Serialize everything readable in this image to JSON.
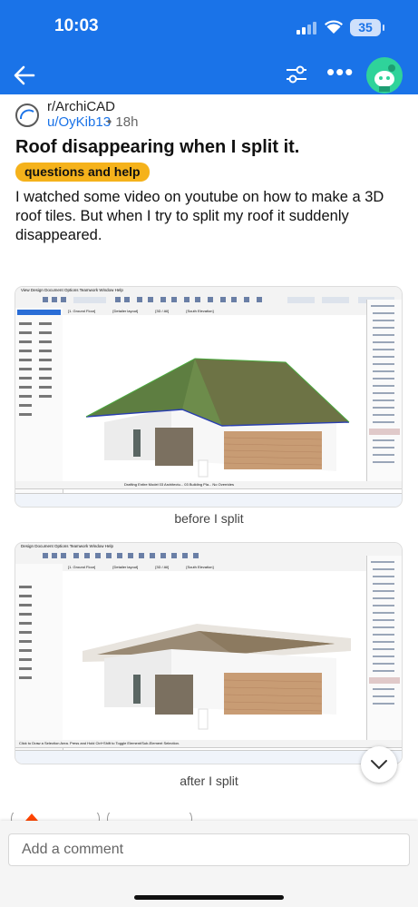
{
  "status_bar": {
    "time": "10:03",
    "battery": "35"
  },
  "toolbar": {
    "back_icon": "arrow-left-icon",
    "filter_icon": "sliders-icon",
    "more_label": "•••",
    "avatar_icon": "avatar"
  },
  "post": {
    "subreddit": "r/ArchiCAD",
    "author": "u/OyKib13",
    "age": "• 18h",
    "title": "Roof disappearing when I split it.",
    "flair": "questions and help",
    "body": "I watched some video on youtube on how to make a 3D roof tiles. But when I try to split my roof it suddenly disappeared.",
    "images": [
      {
        "caption": "before I split",
        "menu": "View  Design  Document  Options  Teamwork  Window  Help",
        "tabs": [
          "[1. Ground Floor]",
          "[Detailer layout]",
          "[3D / All]",
          "[South Elevation]"
        ],
        "status": "Drafting    Entire Model    03 Architectu...    03 Building Pla...    No Overrides"
      },
      {
        "caption": "after I split",
        "menu": "Design  Document  Options  Teamwork  Window  Help",
        "tabs": [
          "[1. Ground Floor]",
          "[Detailer layout]",
          "[3D / All]",
          "[South Elevation]"
        ],
        "status": "Click to Draw a Selection Area. Press and Hold Ctrl+Shift to Toggle Element/Sub-Element Selection."
      }
    ],
    "expand_icon": "chevron-down-icon"
  },
  "comment": {
    "placeholder": "Add a comment"
  },
  "colors": {
    "brand": "#1a73e8",
    "flair": "#f5b21b",
    "avatar": "#2fd39a"
  }
}
